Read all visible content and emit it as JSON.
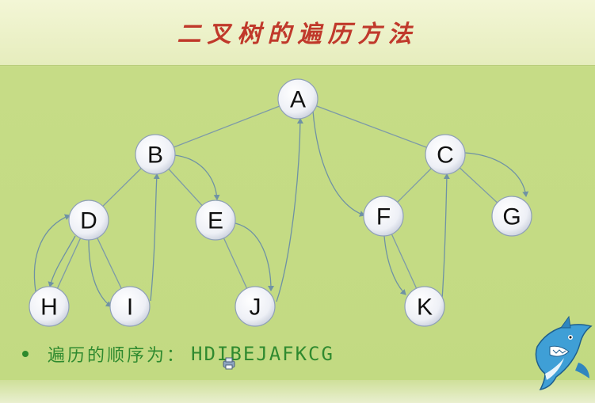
{
  "title": "二叉树的遍历方法",
  "caption": "遍历的顺序为：",
  "result": "HDIBEJAFKCG",
  "nodes": {
    "A": "A",
    "B": "B",
    "C": "C",
    "D": "D",
    "E": "E",
    "F": "F",
    "G": "G",
    "H": "H",
    "I": "I",
    "J": "J",
    "K": "K"
  },
  "colors": {
    "title": "#c0392b",
    "text": "#2f8a2f",
    "background": "#c2da82"
  },
  "icons": [
    "cursor-icon",
    "shark-icon"
  ]
}
